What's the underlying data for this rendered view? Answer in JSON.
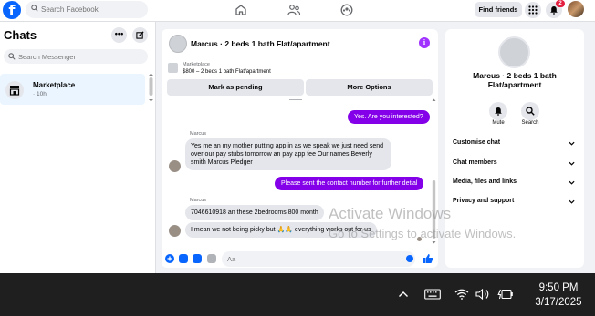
{
  "topbar": {
    "logo": "f",
    "search_placeholder": "Search Facebook",
    "find_friends_label": "Find friends",
    "notification_count": "2",
    "accent": "#0866ff"
  },
  "sidebar": {
    "title": "Chats",
    "search_placeholder": "Search Messenger",
    "chats": [
      {
        "name": "Marketplace",
        "time": "· 10h",
        "icon": "storefront-icon"
      }
    ]
  },
  "conversation": {
    "header_title": "Marcus · 2 beds 1 bath Flat/apartment",
    "marketplace_label": "Marketplace",
    "listing": "$800 – 2 beds 1 bath Flat/apartment",
    "mark_pending_label": "Mark as pending",
    "more_options_label": "More Options",
    "outgoing_color": "#8300e8",
    "messages": [
      {
        "direction": "out",
        "text": "Yes. Are you interested?"
      },
      {
        "direction": "in",
        "sender": "Marcus",
        "text": "Yes me an my mother putting app in as we speak we just need send over our pay stubs tomorrow an pay app fee Our names Beverly smith Marcus Pledger"
      },
      {
        "direction": "out",
        "text": "Please sent the contact number for further detial"
      },
      {
        "direction": "in",
        "sender": "Marcus",
        "text": "7046610918 an these 2bedrooms 800 month"
      },
      {
        "direction": "in",
        "text": "I mean we not being picky but 🙏🙏 everything works out for us"
      }
    ],
    "composer_placeholder": "Aa"
  },
  "details": {
    "title": "Marcus · 2 beds 1 bath Flat/apartment",
    "actions": [
      {
        "label": "Mute",
        "icon": "bell-icon"
      },
      {
        "label": "Search",
        "icon": "search-icon"
      }
    ],
    "sections": [
      "Customise chat",
      "Chat members",
      "Media, files and links",
      "Privacy and support"
    ]
  },
  "watermark": {
    "title": "Activate Windows",
    "subtitle": "Go to Settings to activate Windows."
  },
  "taskbar": {
    "time": "9:50 PM",
    "date": "3/17/2025"
  }
}
